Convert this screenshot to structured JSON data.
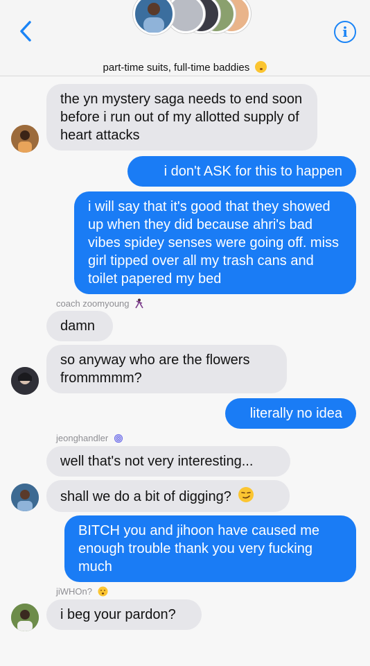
{
  "header": {
    "back_icon": "chevron-left-icon",
    "info_icon": "info-circle-icon",
    "info_glyph": "i",
    "group_name": "part-time suits, full-time baddies",
    "group_emoji": "face-with-hand-over-mouth-emoji",
    "accent_color": "#1a84f6"
  },
  "messages": [
    {
      "text": "the yn mystery saga needs to end soon before i run out of my allotted supply of heart attacks",
      "direction": "incoming"
    },
    {
      "text": "i don't ASK for this to happen",
      "direction": "outgoing"
    },
    {
      "text": "i will say that it's good that they showed up when they did because ahri's bad vibes spidey senses were going off. miss girl tipped over all my trash cans and toilet papered my bed",
      "direction": "outgoing"
    },
    {
      "sender": "coach zoomyoung",
      "sender_emoji": "dancer-emoji"
    },
    {
      "text": "damn",
      "direction": "incoming"
    },
    {
      "text": "so anyway who are the flowers frommmmm?",
      "direction": "incoming"
    },
    {
      "text": "literally no idea",
      "direction": "outgoing"
    },
    {
      "sender": "jeonghandler",
      "sender_emoji": "fingerprint-emoji"
    },
    {
      "text": "well that's not very interesting...",
      "direction": "incoming"
    },
    {
      "text": "shall we do a bit of digging?",
      "direction": "incoming",
      "emoji": "smirking-face-emoji"
    },
    {
      "text": "BITCH you and jihoon have caused me enough trouble thank you very fucking much",
      "direction": "outgoing"
    },
    {
      "sender": "jiWHOn?",
      "sender_emoji": "shushing-face-emoji"
    },
    {
      "text": "i beg your pardon?",
      "direction": "incoming"
    }
  ],
  "colors": {
    "outgoing_bubble": "#1a7cf5",
    "incoming_bubble": "#e6e6ea",
    "background": "#f7f7f7",
    "sender_label": "#8e8e93"
  }
}
